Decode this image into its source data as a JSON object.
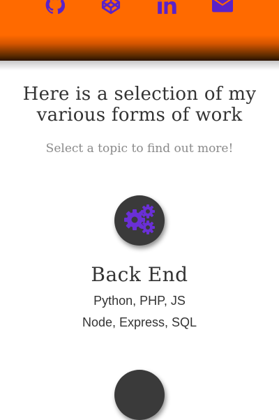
{
  "header": {
    "background_color": "#ff6a00",
    "icon_color": "#5b22c8",
    "social_links": [
      {
        "icon": "github-icon"
      },
      {
        "icon": "codepen-icon"
      },
      {
        "icon": "linkedin-icon"
      },
      {
        "icon": "email-icon"
      }
    ]
  },
  "work_section": {
    "title": "Here is a selection of my various forms of work",
    "subtitle": "Select a topic to find out more!"
  },
  "topics": [
    {
      "icon": "gears-icon",
      "title": "Back End",
      "lines": [
        "Python, PHP, JS",
        "Node, Express, SQL"
      ]
    },
    {
      "icon": "topic-icon"
    }
  ]
}
